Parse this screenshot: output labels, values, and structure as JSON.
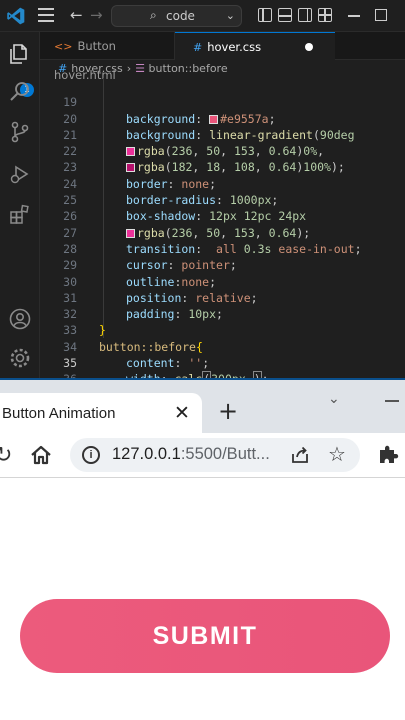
{
  "vscode": {
    "search_text": "code",
    "tabs": [
      {
        "label": "Button hover.html",
        "icon": "html-file-icon"
      },
      {
        "label": "hover.css",
        "icon": "css-file-icon",
        "modified": true
      }
    ],
    "breadcrumb": {
      "file": "hover.css",
      "symbol": "button::before"
    },
    "lines": [
      {
        "n": "19",
        "text": "background: #e9557a;"
      },
      {
        "n": "20",
        "text": "background: linear-gradient(90deg"
      },
      {
        "n": "21",
        "text": "rgba(236, 50, 153, 0.64)0%,"
      },
      {
        "n": "22",
        "text": "rgba(182, 18, 108, 0.64)100%);"
      },
      {
        "n": "23",
        "text": "border: none;"
      },
      {
        "n": "24",
        "text": "border-radius: 1000px;"
      },
      {
        "n": "25",
        "text": "box-shadow: 12px 12pc 24px"
      },
      {
        "n": "26",
        "text": "rgba(236, 50, 153, 0.64);"
      },
      {
        "n": "27",
        "text": "transition:  all 0.3s ease-in-out;"
      },
      {
        "n": "28",
        "text": "cursor: pointer;"
      },
      {
        "n": "29",
        "text": "outline:none;"
      },
      {
        "n": "30",
        "text": "position: relative;"
      },
      {
        "n": "31",
        "text": "padding: 10px;"
      },
      {
        "n": "32",
        "text": "}"
      },
      {
        "n": "33",
        "text": "button::before{"
      },
      {
        "n": "34",
        "text": "content: '';"
      },
      {
        "n": "35",
        "text": "width: calc(300px );"
      },
      {
        "n": "36",
        "text": "}"
      }
    ],
    "swatch_colors": {
      "line19": "#e9557a",
      "line21": "#ec3299",
      "line22": "#b6126c",
      "line26": "#ec3299"
    },
    "badge": "1"
  },
  "browser": {
    "tab_title": "Button Animation",
    "url_host": "127.0.0.1",
    "url_rest": ":5500/Butt...",
    "button_label": "SUBMIT"
  }
}
